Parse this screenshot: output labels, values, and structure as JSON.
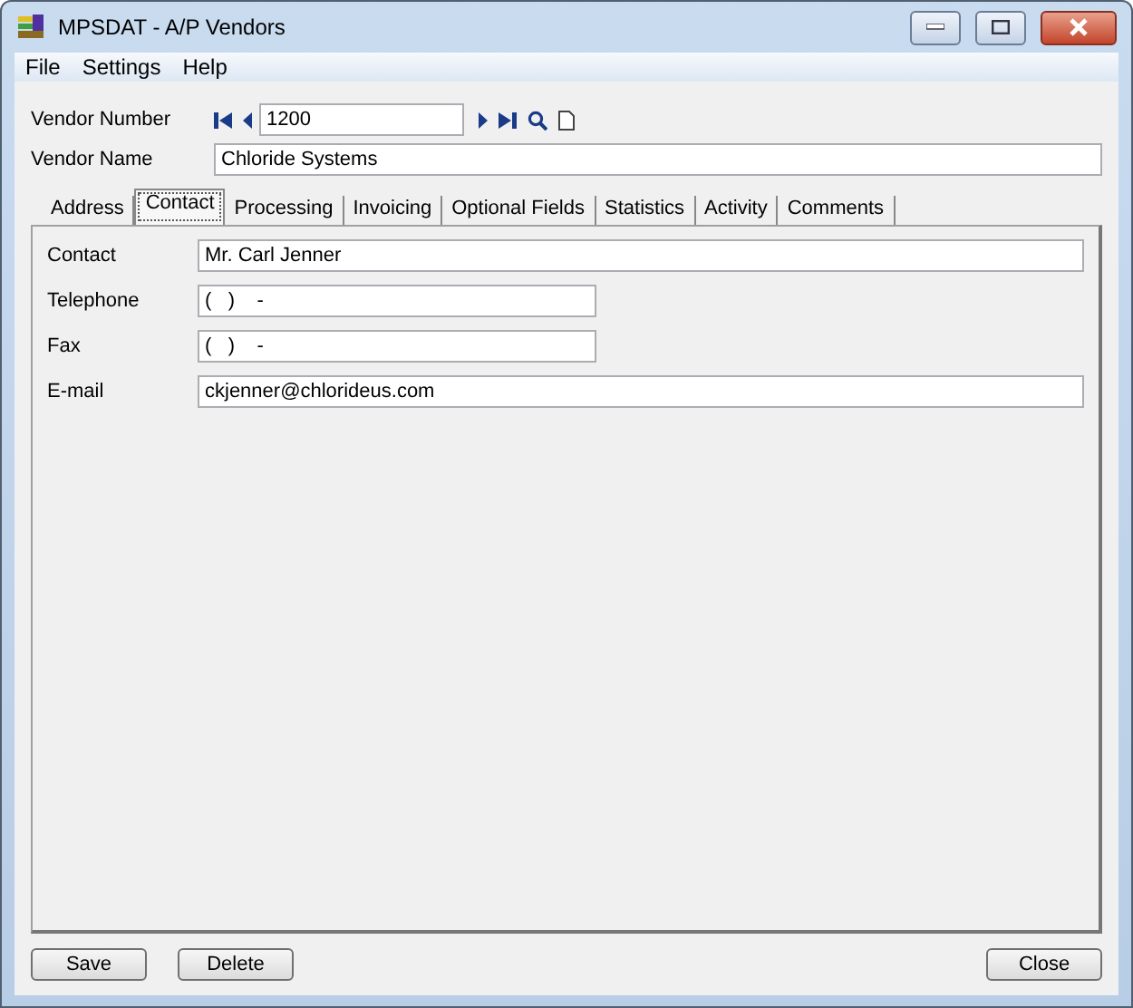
{
  "window": {
    "title": "MPSDAT - A/P Vendors"
  },
  "menu": [
    "File",
    "Settings",
    "Help"
  ],
  "vendor_number": {
    "label": "Vendor Number",
    "value": "1200"
  },
  "vendor_name": {
    "label": "Vendor Name",
    "value": "Chloride Systems"
  },
  "tabs": [
    {
      "label": "Address",
      "selected": false
    },
    {
      "label": "Contact",
      "selected": true
    },
    {
      "label": "Processing",
      "selected": false
    },
    {
      "label": "Invoicing",
      "selected": false
    },
    {
      "label": "Optional Fields",
      "selected": false
    },
    {
      "label": "Statistics",
      "selected": false
    },
    {
      "label": "Activity",
      "selected": false
    },
    {
      "label": "Comments",
      "selected": false
    }
  ],
  "fields": [
    {
      "label": "Contact",
      "value": "Mr. Carl Jenner",
      "kind": "wide"
    },
    {
      "label": "Telephone",
      "value": "(   )    -",
      "kind": "short"
    },
    {
      "label": "Fax",
      "value": "(   )    -",
      "kind": "short"
    },
    {
      "label": "E-mail",
      "value": "ckjenner@chlorideus.com",
      "kind": "wide"
    }
  ],
  "buttons": [
    "Save",
    "Delete",
    "Close"
  ]
}
